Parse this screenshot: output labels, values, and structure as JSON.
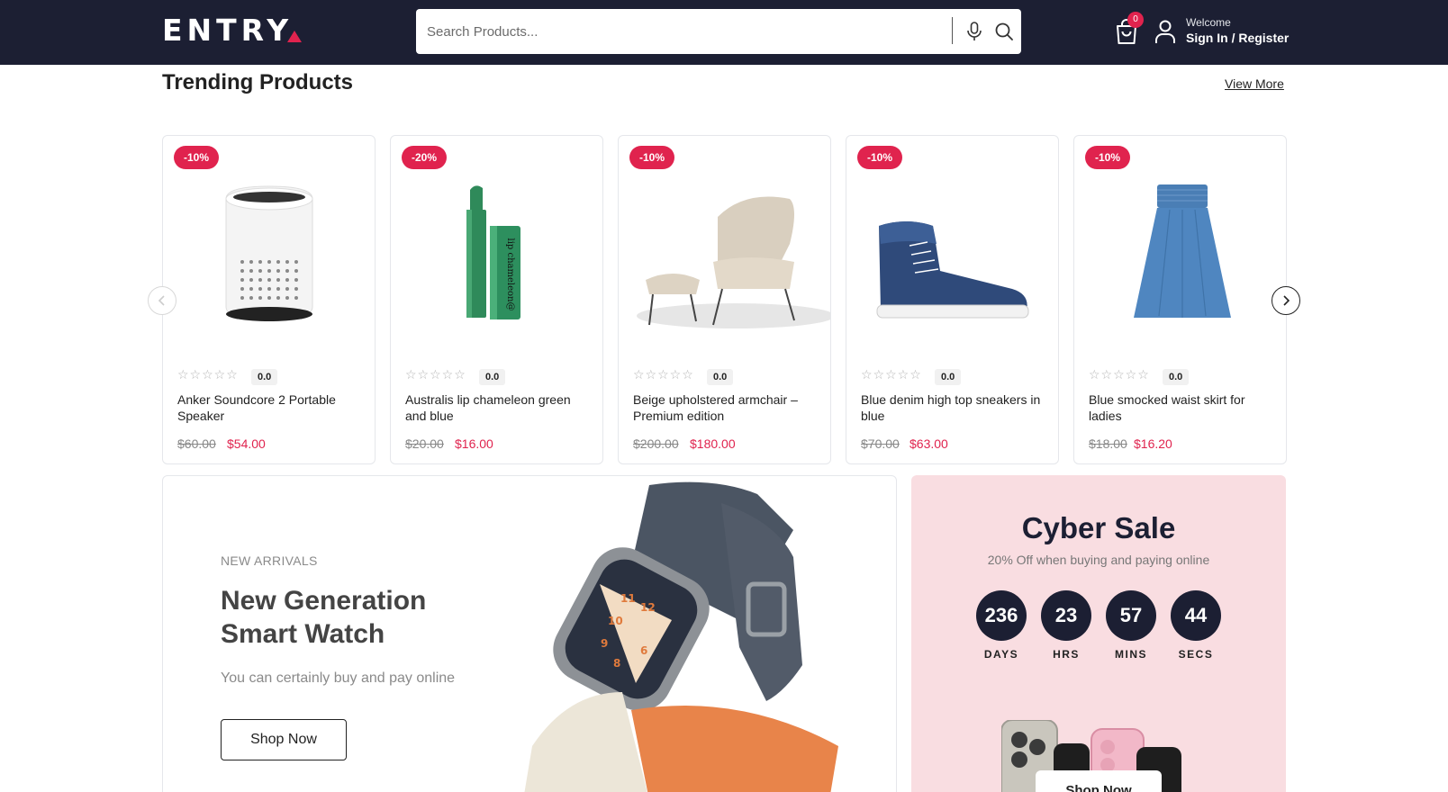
{
  "header": {
    "logo": "ENTRY",
    "search_placeholder": "Search Products...",
    "cart_count": "0",
    "welcome": "Welcome",
    "sign_in": "Sign In",
    "separator": "/",
    "register": "Register"
  },
  "trending": {
    "title": "Trending Products",
    "view_more": "View More",
    "products": [
      {
        "badge": "-10%",
        "stars": "☆☆☆☆☆",
        "rating": "0.0",
        "name": "Anker Soundcore 2 Portable Speaker",
        "old_price": "$60.00",
        "price": "$54.00",
        "image": "air-purifier"
      },
      {
        "badge": "-20%",
        "stars": "☆☆☆☆☆",
        "rating": "0.0",
        "name": "Australis lip chameleon green and blue",
        "old_price": "$20.00",
        "price": "$16.00",
        "image": "lipstick"
      },
      {
        "badge": "-10%",
        "stars": "☆☆☆☆☆",
        "rating": "0.0",
        "name": "Beige upholstered armchair – Premium edition",
        "old_price": "$200.00",
        "price": "$180.00",
        "image": "armchair"
      },
      {
        "badge": "-10%",
        "stars": "☆☆☆☆☆",
        "rating": "0.0",
        "name": "Blue denim high top sneakers in blue",
        "old_price": "$70.00",
        "price": "$63.00",
        "image": "sneaker"
      },
      {
        "badge": "-10%",
        "stars": "☆☆☆☆☆",
        "rating": "0.0",
        "name": "Blue smocked waist skirt for ladies",
        "old_price": "$18.00",
        "price": "$16.20",
        "image": "skirt"
      }
    ]
  },
  "banner": {
    "eyebrow": "NEW ARRIVALS",
    "title": "New Generation Smart Watch",
    "subtitle": "You can certainly buy and pay online",
    "button": "Shop Now"
  },
  "cyber": {
    "title": "Cyber Sale",
    "subtitle": "20% Off when buying and paying online",
    "countdown": [
      {
        "value": "236",
        "label": "DAYS"
      },
      {
        "value": "23",
        "label": "HRS"
      },
      {
        "value": "57",
        "label": "MINS"
      },
      {
        "value": "44",
        "label": "SECS"
      }
    ],
    "button": "Shop Now"
  },
  "colors": {
    "header_bg": "#1c1f33",
    "accent": "#e0234e",
    "cyber_bg": "#f9dde1"
  }
}
